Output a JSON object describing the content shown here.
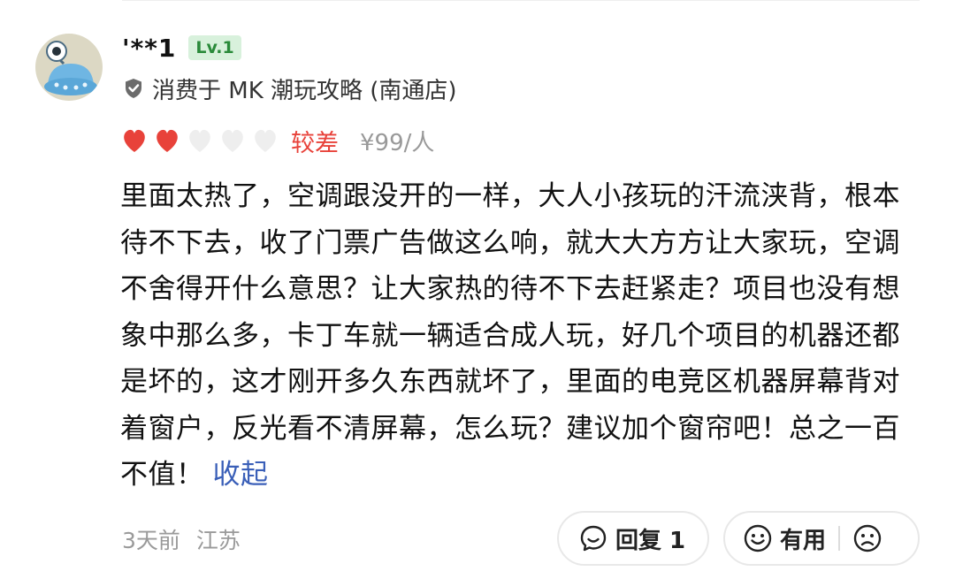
{
  "review": {
    "user": {
      "name": "'**1",
      "level": "Lv.1"
    },
    "shop_line": "消费于 MK 潮玩攻略 (南通店)",
    "rating": {
      "filled_hearts": 2,
      "total_hearts": 5,
      "label": "较差",
      "price": "¥99/人"
    },
    "body": "里面太热了，空调跟没开的一样，大人小孩玩的汗流浃背，根本待不下去，收了门票广告做这么响，就大大方方让大家玩，空调不舍得开什么意思？让大家热的待不下去赶紧走？项目也没有想象中那么多，卡丁车就一辆适合成人玩，好几个项目的机器还都是坏的，这才刚开多久东西就坏了，里面的电竞区机器屏幕背对着窗户，反光看不清屏幕，怎么玩？建议加个窗帘吧！总之一百不值！",
    "collapse_label": "收起",
    "time": "3天前",
    "location": "江苏",
    "actions": {
      "reply_label": "回复 1",
      "useful_label": "有用"
    }
  },
  "colors": {
    "heart_filled": "#e8423a",
    "heart_empty": "#eeeeee",
    "rating_text": "#e8423a",
    "link": "#3a5fb8",
    "level_badge_bg": "#d8f1dc",
    "level_badge_text": "#2a8a3a"
  },
  "icons": {
    "avatar": "robot-avatar",
    "shop": "verified-shield-icon",
    "reply": "comment-bubble-icon",
    "useful": "smile-face-icon",
    "not_useful": "frown-face-icon"
  }
}
